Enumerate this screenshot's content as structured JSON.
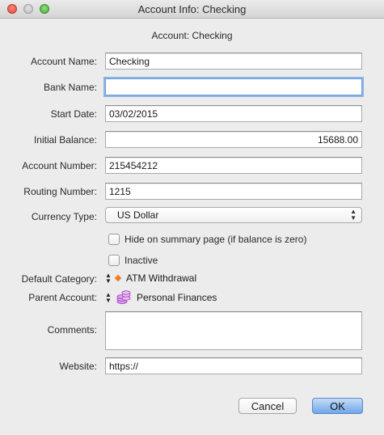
{
  "window": {
    "title": "Account Info: Checking"
  },
  "heading": "Account: Checking",
  "fields": {
    "account_name": {
      "label": "Account Name:",
      "value": "Checking"
    },
    "bank_name": {
      "label": "Bank Name:",
      "value": ""
    },
    "start_date": {
      "label": "Start Date:",
      "value": "03/02/2015"
    },
    "initial_balance": {
      "label": "Initial Balance:",
      "value": "15688.00"
    },
    "account_number": {
      "label": "Account Number:",
      "value": "215454212"
    },
    "routing_number": {
      "label": "Routing Number:",
      "value": "1215"
    },
    "currency_type": {
      "label": "Currency Type:",
      "value": "US Dollar"
    },
    "comments": {
      "label": "Comments:",
      "value": ""
    },
    "website": {
      "label": "Website:",
      "value": "https://"
    }
  },
  "checkboxes": {
    "hide_summary": {
      "label": "Hide on summary page (if balance is zero)",
      "checked": false
    },
    "inactive": {
      "label": "Inactive",
      "checked": false
    }
  },
  "default_category": {
    "label": "Default Category:",
    "value": "ATM Withdrawal",
    "icon": "orange-diamond-icon",
    "icon_color": "#f07c24"
  },
  "parent_account": {
    "label": "Parent Account:",
    "value": "Personal Finances",
    "icon": "coin-stack-icon",
    "icon_color": "#b24fc9"
  },
  "buttons": {
    "cancel": "Cancel",
    "ok": "OK"
  }
}
